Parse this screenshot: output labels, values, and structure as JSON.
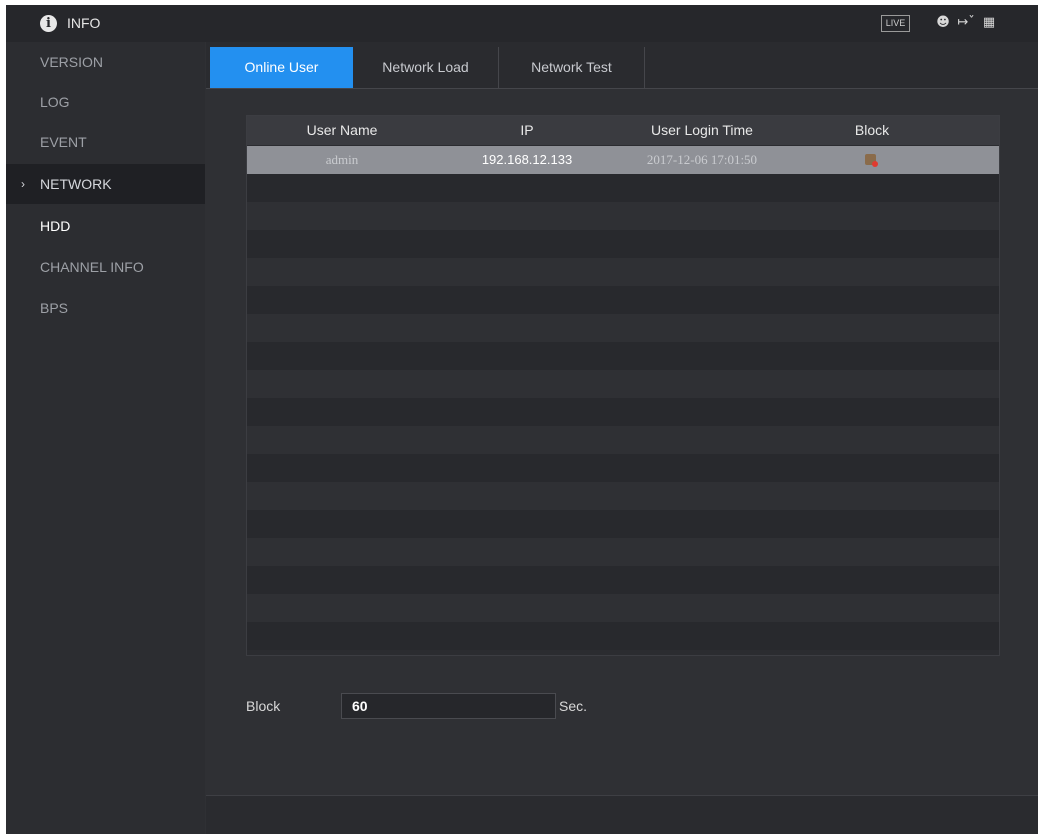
{
  "header": {
    "title": "INFO",
    "title_icon": "info-icon",
    "live_label": "LIVE",
    "icons": [
      "user-icon",
      "logout-icon",
      "grid-icon"
    ]
  },
  "sidebar": {
    "items": [
      {
        "label": "VERSION"
      },
      {
        "label": "LOG"
      },
      {
        "label": "EVENT"
      },
      {
        "label": "NETWORK",
        "active": true
      },
      {
        "label": "HDD"
      },
      {
        "label": "CHANNEL INFO"
      },
      {
        "label": "BPS"
      }
    ]
  },
  "tabs": [
    {
      "label": "Online User",
      "active": true
    },
    {
      "label": "Network Load"
    },
    {
      "label": "Network Test"
    }
  ],
  "table": {
    "columns": [
      "User Name",
      "IP",
      "User Login Time",
      "Block"
    ],
    "rows": [
      {
        "user_name": "admin",
        "ip": "192.168.12.133",
        "login_time": "2017-12-06 17:01:50",
        "block_icon": "block-user-icon"
      }
    ]
  },
  "block": {
    "label": "Block",
    "value": "60",
    "unit": "Sec."
  },
  "colors": {
    "accent": "#2390f0",
    "background": "#2f3034",
    "selected_row": "#8f9197"
  }
}
